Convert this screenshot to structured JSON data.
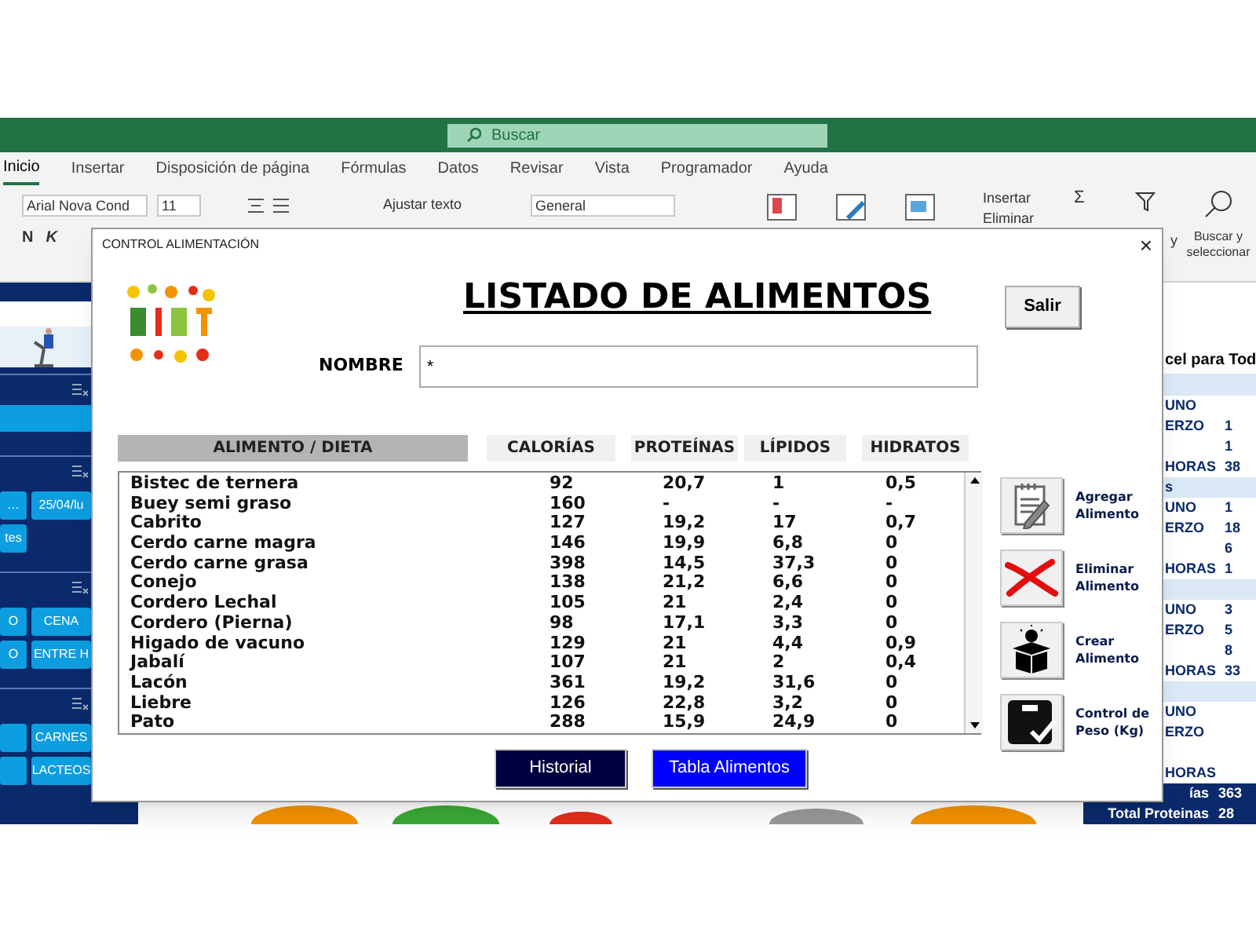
{
  "excel": {
    "search": {
      "placeholder": "Buscar"
    },
    "tabs": [
      {
        "label": "Inicio",
        "selected": true
      },
      {
        "label": "Insertar",
        "selected": false
      },
      {
        "label": "Disposición de página",
        "selected": false
      },
      {
        "label": "Fórmulas",
        "selected": false
      },
      {
        "label": "Datos",
        "selected": false
      },
      {
        "label": "Revisar",
        "selected": false
      },
      {
        "label": "Vista",
        "selected": false
      },
      {
        "label": "Programador",
        "selected": false
      },
      {
        "label": "Ayuda",
        "selected": false
      }
    ],
    "font_name": "Arial Nova Cond",
    "font_size": "11",
    "wrap_text": "Ajustar texto",
    "number_format": "General",
    "insert": "Insertar",
    "delete": "Eliminar",
    "sum": "Σ",
    "sort_filter": "y",
    "find_select": "Buscar y seleccionar",
    "bold": "N",
    "italic": "K",
    "left_panel": {
      "sections": [
        {
          "kind": "bar"
        },
        {
          "rows": [
            {
              "left": "…",
              "right": "25/04/lu"
            },
            {
              "left": "tes"
            }
          ]
        },
        {
          "rows": [
            {
              "left": "O",
              "right": "CENA"
            },
            {
              "left": "O",
              "right": "ENTRE H"
            }
          ]
        },
        {
          "rows": [
            {
              "right": "CARNES"
            },
            {
              "right": "LACTEOS"
            }
          ]
        }
      ]
    },
    "sheet": {
      "title": "cel para Tod",
      "rows": [
        {
          "kind": "row",
          "label": "UNO"
        },
        {
          "kind": "row",
          "label": "ERZO",
          "value": "1"
        },
        {
          "kind": "row",
          "value": "1"
        },
        {
          "kind": "row",
          "label": "HORAS",
          "value": "38"
        },
        {
          "kind": "header",
          "label": "s"
        },
        {
          "kind": "row",
          "label": "UNO",
          "value": "1"
        },
        {
          "kind": "row",
          "label": "ERZO",
          "value": "18"
        },
        {
          "kind": "row",
          "value": "6"
        },
        {
          "kind": "row",
          "label": "HORAS",
          "value": "1"
        },
        {
          "kind": "header"
        },
        {
          "kind": "row",
          "label": "UNO",
          "value": "3"
        },
        {
          "kind": "row",
          "label": "ERZO",
          "value": "5"
        },
        {
          "kind": "row",
          "value": "8"
        },
        {
          "kind": "row",
          "label": "HORAS",
          "value": "33"
        },
        {
          "kind": "header"
        },
        {
          "kind": "row",
          "label": "UNO"
        },
        {
          "kind": "row",
          "label": "ERZO"
        },
        {
          "kind": "row"
        },
        {
          "kind": "row",
          "label": "HORAS"
        },
        {
          "kind": "total",
          "label": "ías",
          "value": "363"
        },
        {
          "kind": "total",
          "label": "Total Proteinas",
          "value": "28"
        }
      ]
    }
  },
  "dialog": {
    "title": "CONTROL ALIMENTACIÓN",
    "close": "×",
    "heading": "LISTADO DE ALIMENTOS",
    "exit": "Salir",
    "name_label": "NOMBRE",
    "name_value": "*",
    "columns": [
      "ALIMENTO / DIETA",
      "CALORÍAS",
      "PROTEÍNAS",
      "LÍPIDOS",
      "HIDRATOS"
    ],
    "rows": [
      [
        "Bistec de ternera",
        "92",
        "20,7",
        "1",
        "0,5"
      ],
      [
        "Buey semi graso",
        "160",
        "-",
        "-",
        "-"
      ],
      [
        "Cabrito",
        "127",
        "19,2",
        "17",
        "0,7"
      ],
      [
        "Cerdo carne magra",
        "146",
        "19,9",
        "6,8",
        "0"
      ],
      [
        "Cerdo carne grasa",
        "398",
        "14,5",
        "37,3",
        "0"
      ],
      [
        "Conejo",
        "138",
        "21,2",
        "6,6",
        "0"
      ],
      [
        "Cordero Lechal",
        "105",
        "21",
        "2,4",
        "0"
      ],
      [
        "Cordero (Pierna)",
        "98",
        "17,1",
        "3,3",
        "0"
      ],
      [
        "Higado de vacuno",
        "129",
        "21",
        "4,4",
        "0,9"
      ],
      [
        "Jabalí",
        "107",
        "21",
        "2",
        "0,4"
      ],
      [
        "Lacón",
        "361",
        "19,2",
        "31,6",
        "0"
      ],
      [
        "Liebre",
        "126",
        "22,8",
        "3,2",
        "0"
      ],
      [
        "Pato",
        "288",
        "15,9",
        "24,9",
        "0"
      ]
    ],
    "actions": [
      {
        "kind": "add",
        "label": "Agregar Alimento"
      },
      {
        "kind": "delete",
        "label": "Eliminar Alimento"
      },
      {
        "kind": "create",
        "label": "Crear Alimento"
      },
      {
        "kind": "weight",
        "label": "Control de Peso (Kg)"
      }
    ],
    "bottom_buttons": [
      {
        "label": "Historial",
        "color": "#000040"
      },
      {
        "label": "Tabla Alimentos",
        "color": "#0000ff"
      }
    ]
  }
}
